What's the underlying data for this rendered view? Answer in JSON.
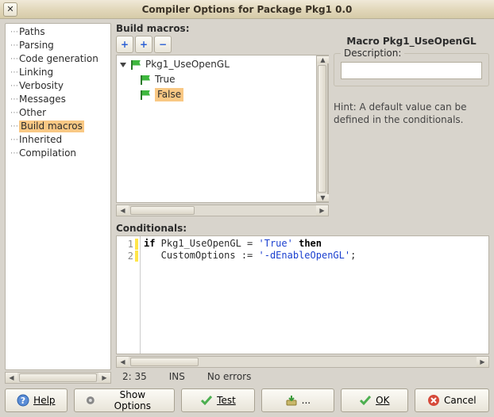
{
  "window": {
    "title": "Compiler Options for Package Pkg1 0.0",
    "close_glyph": "✕"
  },
  "sidebar": {
    "items": [
      {
        "label": "Paths"
      },
      {
        "label": "Parsing"
      },
      {
        "label": "Code generation"
      },
      {
        "label": "Linking"
      },
      {
        "label": "Verbosity"
      },
      {
        "label": "Messages"
      },
      {
        "label": "Other"
      },
      {
        "label": "Build macros"
      },
      {
        "label": "Inherited"
      },
      {
        "label": "Compilation"
      }
    ],
    "selected_index": 7
  },
  "build_macros": {
    "section_label": "Build macros:",
    "toolbar": {
      "add_glyph": "+",
      "add2_glyph": "+",
      "remove_glyph": "−"
    },
    "tree": {
      "root": {
        "label": "Pkg1_UseOpenGL"
      },
      "children": [
        {
          "label": "True"
        },
        {
          "label": "False"
        }
      ],
      "selected_child_index": 1
    }
  },
  "macro_props": {
    "heading": "Macro Pkg1_UseOpenGL",
    "description_label": "Description:",
    "description_value": "",
    "hint": "Hint: A default value can be defined in the conditionals."
  },
  "conditionals": {
    "section_label": "Conditionals:",
    "lines": [
      {
        "n": "1",
        "tokens": [
          {
            "t": "kw",
            "v": "if"
          },
          {
            "t": "p",
            "v": " Pkg1_UseOpenGL = "
          },
          {
            "t": "str",
            "v": "'True'"
          },
          {
            "t": "p",
            "v": " "
          },
          {
            "t": "kw",
            "v": "then"
          }
        ]
      },
      {
        "n": "2",
        "tokens": [
          {
            "t": "p",
            "v": "   CustomOptions := "
          },
          {
            "t": "str",
            "v": "'-dEnableOpenGL'"
          },
          {
            "t": "p",
            "v": ";"
          }
        ]
      }
    ]
  },
  "status": {
    "pos": "2: 35",
    "mode": "INS",
    "msg": "No errors"
  },
  "buttons": {
    "help": "Help",
    "show_options": "Show Options",
    "test": "Test",
    "ellipsis": "...",
    "ok": "OK",
    "cancel": "Cancel"
  },
  "scroll_glyphs": {
    "left": "◀",
    "right": "▶",
    "up": "▲",
    "down": "▼"
  }
}
